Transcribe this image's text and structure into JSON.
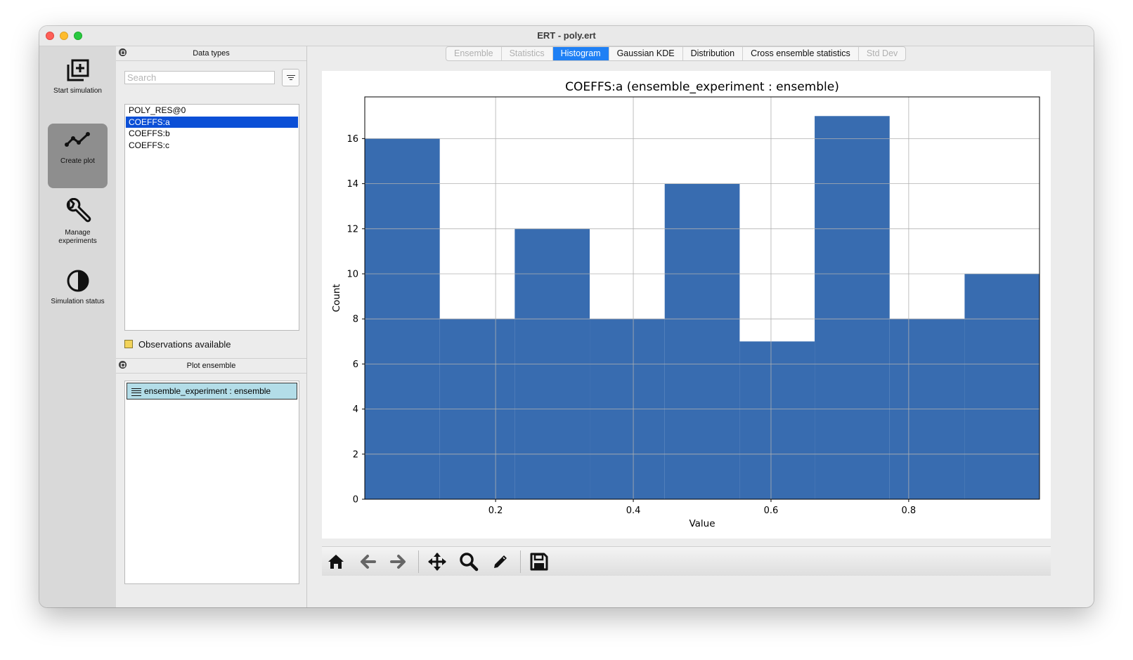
{
  "window": {
    "title": "ERT - poly.ert"
  },
  "nav": {
    "items": [
      {
        "label": "Start simulation",
        "icon": "add-box-icon",
        "active": false
      },
      {
        "label": "Create plot",
        "icon": "line-chart-icon",
        "active": true
      },
      {
        "label": "Manage experiments",
        "icon": "wrench-icon",
        "active": false
      },
      {
        "label": "Simulation status",
        "icon": "contrast-circle-icon",
        "active": false
      }
    ]
  },
  "data_types": {
    "title": "Data types",
    "search_placeholder": "Search",
    "items": [
      "POLY_RES@0",
      "COEFFS:a",
      "COEFFS:b",
      "COEFFS:c"
    ],
    "selected": "COEFFS:a",
    "observations_label": "Observations available"
  },
  "plot_ensemble": {
    "title": "Plot ensemble",
    "items": [
      "ensemble_experiment : ensemble"
    ]
  },
  "tabs": {
    "items": [
      "Ensemble",
      "Statistics",
      "Histogram",
      "Gaussian KDE",
      "Distribution",
      "Cross ensemble statistics",
      "Std Dev"
    ],
    "active": "Histogram",
    "disabled": [
      "Ensemble",
      "Statistics",
      "Std Dev"
    ]
  },
  "colors": {
    "bar": "#386cb0",
    "accent": "#1f80f5",
    "selection": "#0b4fd6"
  },
  "chart_data": {
    "type": "bar",
    "title": "COEFFS:a (ensemble_experiment : ensemble)",
    "xlabel": "Value",
    "ylabel": "Count",
    "bin_edges": [
      0.01,
      0.1189,
      0.2278,
      0.3367,
      0.4456,
      0.5545,
      0.6634,
      0.7723,
      0.8812,
      0.99
    ],
    "values": [
      16,
      8,
      12,
      8,
      14,
      7,
      17,
      8,
      10
    ],
    "xlim": [
      0.01,
      0.99
    ],
    "ylim": [
      0,
      17.85
    ],
    "xticks": [
      0.2,
      0.4,
      0.6,
      0.8
    ],
    "xtick_labels": [
      "0.2",
      "0.4",
      "0.6",
      "0.8"
    ],
    "yticks": [
      0,
      2,
      4,
      6,
      8,
      10,
      12,
      14,
      16
    ],
    "ytick_labels": [
      "0",
      "2",
      "4",
      "6",
      "8",
      "10",
      "12",
      "14",
      "16"
    ],
    "grid": true
  },
  "toolbar": {
    "buttons": [
      "home-icon",
      "back-arrow-icon",
      "forward-arrow-icon",
      "pan-move-icon",
      "zoom-magnifier-icon",
      "edit-pencil-icon",
      "save-floppy-icon"
    ]
  }
}
